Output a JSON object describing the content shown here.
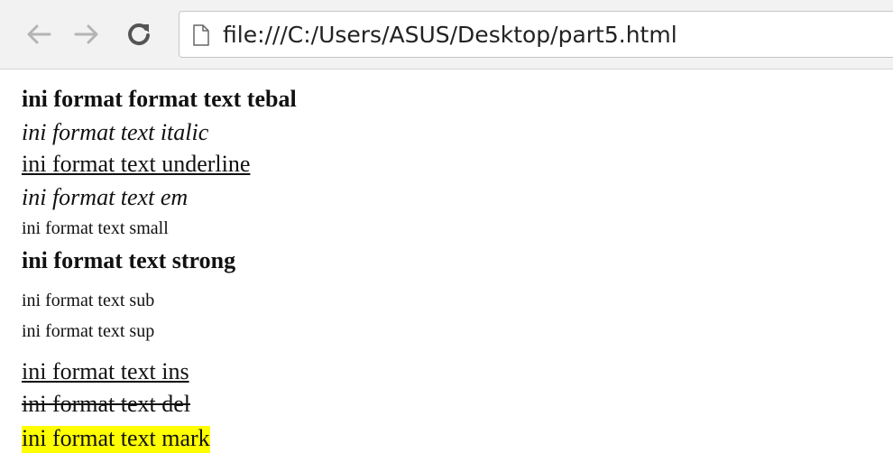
{
  "browser": {
    "url": "file:///C:/Users/ASUS/Desktop/part5.html",
    "back_icon": "arrow-left-icon",
    "forward_icon": "arrow-right-icon",
    "reload_icon": "reload-icon",
    "page_icon": "page-icon"
  },
  "content": {
    "bold": "ini format format text tebal",
    "italic": "ini format text italic",
    "underline": "ini format text underline",
    "em": "ini format text em",
    "small": "ini format text small",
    "strong": "ini format text strong",
    "sub": "ini format text sub",
    "sup": "ini format text sup",
    "ins": "ini format text ins",
    "del": "ini format text del",
    "mark": "ini format text mark"
  },
  "colors": {
    "mark_highlight": "#ffff00",
    "toolbar_bg": "#f2f2f2",
    "nav_disabled": "#b4b4b4",
    "reload": "#555555"
  }
}
